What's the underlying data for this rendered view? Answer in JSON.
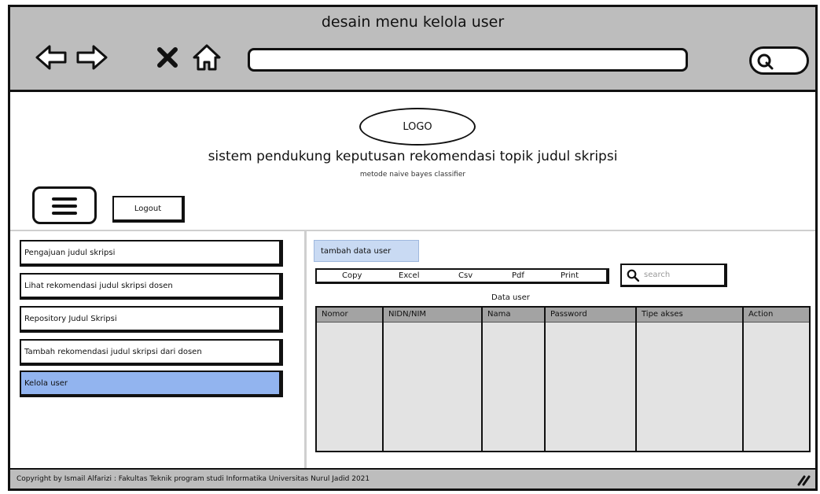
{
  "window": {
    "title": "desain menu kelola user",
    "url": ""
  },
  "header": {
    "logo": "LOGO",
    "title": "sistem pendukung keputusan rekomendasi topik judul skripsi",
    "subtitle": "metode naive bayes classifier",
    "logout_label": "Logout"
  },
  "sidebar": {
    "items": [
      {
        "label": "Pengajuan judul skripsi",
        "active": false
      },
      {
        "label": "Lihat rekomendasi judul skripsi dosen",
        "active": false
      },
      {
        "label": "Repository Judul Skripsi",
        "active": false
      },
      {
        "label": "Tambah rekomendasi judul skripsi dari dosen",
        "active": false
      },
      {
        "label": "Kelola user",
        "active": true
      }
    ]
  },
  "main": {
    "add_button": "tambah data user",
    "export_buttons": [
      "Copy",
      "Excel",
      "Csv",
      "Pdf",
      "Print"
    ],
    "search_placeholder": "search",
    "table_caption": "Data user",
    "table": {
      "columns": [
        "Nomor",
        "NIDN/NIM",
        "Nama",
        "Password",
        "Tipe akses",
        "Action"
      ],
      "rows": [
        [
          "",
          "",
          "",
          "",
          "",
          ""
        ],
        [
          "",
          "",
          "",
          "",
          "",
          ""
        ],
        [
          "",
          "",
          "",
          "",
          "",
          ""
        ],
        [
          "",
          "",
          "",
          "",
          "",
          ""
        ],
        [
          "",
          "",
          "",
          "",
          "",
          ""
        ],
        [
          "",
          "",
          "",
          "",
          "",
          ""
        ]
      ]
    }
  },
  "footer": {
    "copyright": "Copyright by Ismail Alfarizi : Fakultas Teknik program studi Informatika Universitas Nurul Jadid 2021"
  },
  "colors": {
    "chrome": "#bdbdbd",
    "active_item": "#92b4ef",
    "add_button": "#c9daf3",
    "table_header": "#a3a3a3"
  },
  "icons": [
    "back-arrow-icon",
    "forward-arrow-icon",
    "close-icon",
    "home-icon",
    "search-icon",
    "menu-icon",
    "resize-grip-icon"
  ]
}
